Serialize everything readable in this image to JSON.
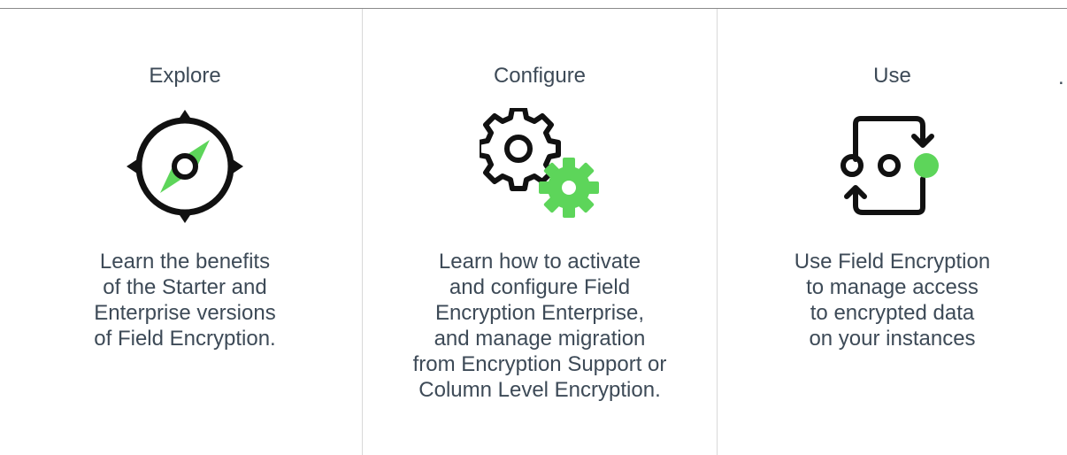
{
  "cards": [
    {
      "title": "Explore",
      "icon": "compass-icon",
      "description": "Learn the benefits\nof the Starter and\nEnterprise versions\nof Field Encryption."
    },
    {
      "title": "Configure",
      "icon": "gears-icon",
      "description": "Learn how to activate\nand configure Field\nEncryption Enterprise,\nand manage migration\nfrom Encryption Support or\nColumn Level Encryption."
    },
    {
      "title": "Use",
      "icon": "cycle-dots-icon",
      "description": "Use Field Encryption\nto manage access\nto encrypted data\non your instances"
    }
  ],
  "stray_mark": ".",
  "colors": {
    "text": "#3d4a57",
    "accent_green": "#5dd55a",
    "icon_stroke": "#111111",
    "divider": "#d9d9d9",
    "top_rule": "#8a8a8a"
  }
}
